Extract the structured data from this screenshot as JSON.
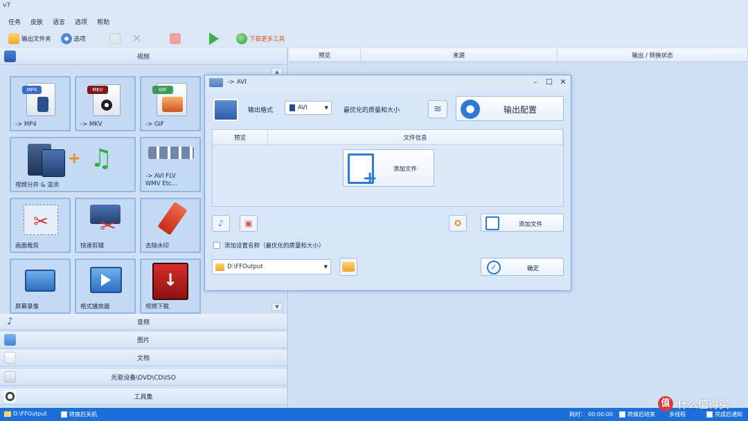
{
  "app": {
    "title": "v7"
  },
  "menu": [
    "任务",
    "皮肤",
    "语言",
    "选项",
    "帮助"
  ],
  "toolbar": {
    "output_folder": "输出文件夹",
    "options": "选项",
    "remove": "",
    "clear": "",
    "stop": "",
    "start": "",
    "install_hint": "下载更多工具"
  },
  "left_panel": {
    "video_header": "视频",
    "tiles": [
      {
        "label": "-> MP4",
        "badge": "MP4"
      },
      {
        "label": "-> MKV",
        "badge": "MKV"
      },
      {
        "label": "-> GIF",
        "badge": "GIF"
      },
      {
        "label": "视频分并 & 混流"
      },
      {
        "label": "-> AVI FLV\nWMV Etc..."
      },
      {
        "label": "画面裁剪"
      },
      {
        "label": "快速剪辑"
      },
      {
        "label": "去除水印"
      },
      {
        "label": "屏幕录像"
      },
      {
        "label": "格式播放器"
      },
      {
        "label": "视频下载"
      }
    ],
    "categories": [
      {
        "label": "音频",
        "icon": "music-note-icon"
      },
      {
        "label": "图片",
        "icon": "image-icon"
      },
      {
        "label": "文档",
        "icon": "document-icon"
      },
      {
        "label": "光驱设备\\DVD\\CD\\ISO",
        "icon": "disc-icon"
      },
      {
        "label": "工具集",
        "icon": "tools-icon"
      }
    ]
  },
  "task_table": {
    "columns": [
      "预览",
      "来源",
      "输出 / 转换状态"
    ]
  },
  "dialog": {
    "title": "-> AVI",
    "output_format_label": "输出格式",
    "output_format_value": "AVI",
    "quality_label": "最优化的质量和大小",
    "output_config": "输出配置",
    "columns": [
      "预览",
      "文件信息"
    ],
    "add_file_big": "添加文件",
    "add_file_small": "添加文件",
    "checkbox_label": "添加设置名称（最优化的质量和大小）",
    "output_path": "D:\\FFOutput",
    "ok": "确定"
  },
  "statusbar": {
    "path": "D:\\FFOutput",
    "shutdown_after": "转换后关机",
    "time_label": "耗时：",
    "time": "00:00:00",
    "after_convert": "转换后结束",
    "multithread": "多线程",
    "sound_hint": "完成后通知"
  },
  "watermark": {
    "icon_text": "值",
    "text": "什么值得买"
  }
}
